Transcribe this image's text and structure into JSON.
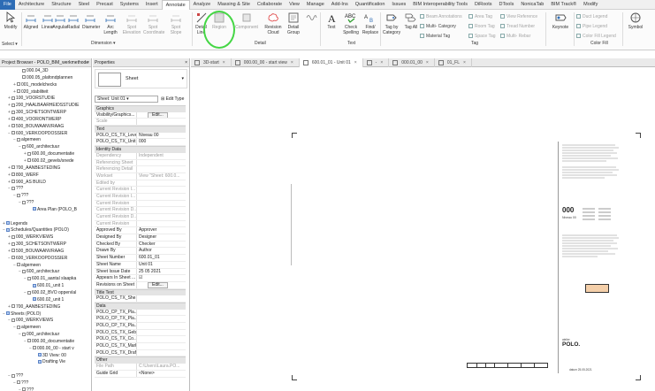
{
  "ribbon_tabs": [
    "File",
    "Architecture",
    "Structure",
    "Steel",
    "Precast",
    "Systems",
    "Insert",
    "Annotate",
    "Analyze",
    "Massing & Site",
    "Collaborate",
    "View",
    "Manage",
    "Add-Ins",
    "Quantification",
    "Issues",
    "BIM Interoperability Tools",
    "DiRoots",
    "DTools",
    "NonicaTab",
    "BIM Track®",
    "Modify"
  ],
  "active_tab": "Annotate",
  "ribbon": {
    "modify": "Modify",
    "select": "Select ▾",
    "dim_tools": [
      "Aligned",
      "Linear",
      "Angular",
      "Radial",
      "Diameter",
      "Arc Length",
      "Spot Elevation",
      "Spot Coordinate",
      "Spot Slope"
    ],
    "dimension_panel": "Dimension ▾",
    "detail_tools": [
      "Detail Line",
      "Region",
      "Component",
      "Revision Cloud",
      "Detail Group",
      "Insulation"
    ],
    "detail_panel": "Detail",
    "text_tools": [
      "Text",
      "Check Spelling",
      "Find/ Replace"
    ],
    "text_panel": "Text",
    "tag_tools": [
      "Tag by Category",
      "Tag All"
    ],
    "tag_small": [
      "Beam Annotations",
      "Multi- Category",
      "Material Tag",
      "Area Tag",
      "Room Tag",
      "Space Tag",
      "View Reference",
      "Tread Number",
      "Multi- Rebar"
    ],
    "tag_panel": "Tag",
    "keynote": "Keynote",
    "color_fill": [
      "Duct Legend",
      "Pipe Legend",
      "Color Fill Legend"
    ],
    "color_fill_panel": "Color Fill",
    "symbol": "Symbol"
  },
  "project_browser": {
    "title": "Project Browser - POLO_BIM_werkmethode",
    "rows": [
      {
        "indent": 3,
        "label": "000.04_3D",
        "toggle": ""
      },
      {
        "indent": 3,
        "label": "000.05_plafondplannen",
        "toggle": ""
      },
      {
        "indent": 2,
        "label": "001_modelchecks",
        "toggle": "+"
      },
      {
        "indent": 2,
        "label": "020_stabiliteit",
        "toggle": "+"
      },
      {
        "indent": 1,
        "label": "100_VOORSTUDIE",
        "toggle": "+"
      },
      {
        "indent": 1,
        "label": "200_HAALBAARHEIDSSTUDIE",
        "toggle": "+"
      },
      {
        "indent": 1,
        "label": "300_SCHETSONTWERP",
        "toggle": "+"
      },
      {
        "indent": 1,
        "label": "400_VOORONTWERP",
        "toggle": "+"
      },
      {
        "indent": 1,
        "label": "500_BOUWAANVRAAG",
        "toggle": "+"
      },
      {
        "indent": 1,
        "label": "600_VERKOOPDOSSIER",
        "toggle": "−"
      },
      {
        "indent": 2,
        "label": "algemeen",
        "toggle": "−"
      },
      {
        "indent": 3,
        "label": "600_architectuur",
        "toggle": "−"
      },
      {
        "indent": 4,
        "label": "600.00_documentatie",
        "toggle": "+"
      },
      {
        "indent": 4,
        "label": "600.02_gevels/snede",
        "toggle": "+"
      },
      {
        "indent": 1,
        "label": "700_AANBESTEDING",
        "toggle": "+"
      },
      {
        "indent": 1,
        "label": "800_WERF",
        "toggle": "+"
      },
      {
        "indent": 1,
        "label": "900_AS BUILD",
        "toggle": "+"
      },
      {
        "indent": 1,
        "label": "???",
        "toggle": "−"
      },
      {
        "indent": 2,
        "label": "???",
        "toggle": "−"
      },
      {
        "indent": 3,
        "label": "???",
        "toggle": "−"
      },
      {
        "indent": 5,
        "label": "Area Plan (POLO_B",
        "toggle": ""
      },
      {
        "indent": 0,
        "label": "",
        "toggle": ""
      },
      {
        "indent": 0,
        "label": "Legends",
        "toggle": "+"
      },
      {
        "indent": 0,
        "label": "Schedules/Quantities (POLO)",
        "toggle": "−"
      },
      {
        "indent": 1,
        "label": "000_WERKVIEWS",
        "toggle": "+"
      },
      {
        "indent": 1,
        "label": "300_SCHETSONTWERP",
        "toggle": "+"
      },
      {
        "indent": 1,
        "label": "500_BOUWAANVRAAG",
        "toggle": "+"
      },
      {
        "indent": 1,
        "label": "600_VERKOOPDOSSIER",
        "toggle": "−"
      },
      {
        "indent": 2,
        "label": "algemeen",
        "toggle": "−"
      },
      {
        "indent": 3,
        "label": "600_architectuur",
        "toggle": "−"
      },
      {
        "indent": 4,
        "label": "600.01_aantal slaapka",
        "toggle": "−"
      },
      {
        "indent": 5,
        "label": "600.01_unit 1",
        "toggle": ""
      },
      {
        "indent": 4,
        "label": "600.02_BVO oppervlal",
        "toggle": "−"
      },
      {
        "indent": 5,
        "label": "600.02_unit 1",
        "toggle": ""
      },
      {
        "indent": 1,
        "label": "700_AANBESTEDING",
        "toggle": "+"
      },
      {
        "indent": 0,
        "label": "Sheets (POLO)",
        "toggle": "−"
      },
      {
        "indent": 1,
        "label": "000_WERKVIEWS",
        "toggle": "−"
      },
      {
        "indent": 2,
        "label": "algemeen",
        "toggle": "−"
      },
      {
        "indent": 3,
        "label": "000_architectuur",
        "toggle": "−"
      },
      {
        "indent": 4,
        "label": "000.00_documentatie",
        "toggle": "−"
      },
      {
        "indent": 5,
        "label": "000.00_00 - start v",
        "toggle": "−"
      },
      {
        "indent": 6,
        "label": "3D View: 00",
        "toggle": ""
      },
      {
        "indent": 6,
        "label": "Drafting Vie",
        "toggle": ""
      },
      {
        "indent": 0,
        "label": "",
        "toggle": ""
      },
      {
        "indent": 1,
        "label": "???",
        "toggle": "−"
      },
      {
        "indent": 2,
        "label": "???",
        "toggle": "−"
      },
      {
        "indent": 3,
        "label": "???",
        "toggle": "−"
      }
    ]
  },
  "properties": {
    "title": "Properties",
    "type_name": "Sheet",
    "instance": "Sheet: Unit 01",
    "edit_type": "Edit Type",
    "edit_label": "Edit...",
    "rows": [
      {
        "kind": "group",
        "name": "Graphics"
      },
      {
        "kind": "row",
        "name": "Visibility/Graphics...",
        "value": "Edit...",
        "dim": false
      },
      {
        "kind": "row",
        "name": "Scale",
        "value": "",
        "dim": true
      },
      {
        "kind": "group",
        "name": "Text"
      },
      {
        "kind": "row",
        "name": "POLO_CS_TX_Level",
        "value": "Niveau 00",
        "dim": false
      },
      {
        "kind": "row",
        "name": "POLO_CS_TX_Unit...",
        "value": "000",
        "dim": false
      },
      {
        "kind": "group",
        "name": "Identity Data"
      },
      {
        "kind": "row",
        "name": "Dependency",
        "value": "Independent",
        "dim": true
      },
      {
        "kind": "row",
        "name": "Referencing Sheet",
        "value": "",
        "dim": true
      },
      {
        "kind": "row",
        "name": "Referencing Detail",
        "value": "",
        "dim": true
      },
      {
        "kind": "row",
        "name": "Workset",
        "value": "View \"Sheet: 600.0...",
        "dim": true
      },
      {
        "kind": "row",
        "name": "Edited by",
        "value": "",
        "dim": true
      },
      {
        "kind": "row",
        "name": "Current Revision I...",
        "value": "",
        "dim": true
      },
      {
        "kind": "row",
        "name": "Current Revision I...",
        "value": "",
        "dim": true
      },
      {
        "kind": "row",
        "name": "Current Revision",
        "value": "",
        "dim": true
      },
      {
        "kind": "row",
        "name": "Current Revision D...",
        "value": "",
        "dim": true
      },
      {
        "kind": "row",
        "name": "Current Revision D...",
        "value": "",
        "dim": true
      },
      {
        "kind": "row",
        "name": "Current Revision",
        "value": "",
        "dim": true
      },
      {
        "kind": "row",
        "name": "Approved By",
        "value": "Approver",
        "dim": false
      },
      {
        "kind": "row",
        "name": "Designed By",
        "value": "Designer",
        "dim": false
      },
      {
        "kind": "row",
        "name": "Checked By",
        "value": "Checker",
        "dim": false
      },
      {
        "kind": "row",
        "name": "Drawn By",
        "value": "Author",
        "dim": false
      },
      {
        "kind": "row",
        "name": "Sheet Number",
        "value": "600.01_01",
        "dim": false
      },
      {
        "kind": "row",
        "name": "Sheet Name",
        "value": "Unit 01",
        "dim": false
      },
      {
        "kind": "row",
        "name": "Sheet Issue Date",
        "value": "25 05 2021",
        "dim": false
      },
      {
        "kind": "row",
        "name": "Appears In Sheet ...",
        "value": "☑",
        "dim": false
      },
      {
        "kind": "row",
        "name": "Revisions on Sheet",
        "value": "Edit...",
        "dim": false
      },
      {
        "kind": "group",
        "name": "Title Text"
      },
      {
        "kind": "row",
        "name": "POLO_CS_TX_She...",
        "value": "",
        "dim": false
      },
      {
        "kind": "group",
        "name": "Data"
      },
      {
        "kind": "row",
        "name": "POLO_CP_TX_Pla...",
        "value": "",
        "dim": false
      },
      {
        "kind": "row",
        "name": "POLO_CP_TX_Pla...",
        "value": "",
        "dim": false
      },
      {
        "kind": "row",
        "name": "POLO_CP_TX_Pla...",
        "value": "",
        "dim": false
      },
      {
        "kind": "row",
        "name": "POLO_CS_TX_Geb...",
        "value": "",
        "dim": false
      },
      {
        "kind": "row",
        "name": "POLO_CS_TX_Co...",
        "value": "",
        "dim": false
      },
      {
        "kind": "row",
        "name": "POLO_CS_TX_Mark",
        "value": "",
        "dim": false
      },
      {
        "kind": "row",
        "name": "POLO_CS_TX_Draf...",
        "value": "",
        "dim": false
      },
      {
        "kind": "group",
        "name": "Other"
      },
      {
        "kind": "row",
        "name": "File Path",
        "value": "C:\\Users\\Laura.PO...",
        "dim": true
      },
      {
        "kind": "row",
        "name": "Guide Grid",
        "value": "<None>",
        "dim": false
      }
    ]
  },
  "view_tabs": [
    "3D-start",
    "000.00_00 - start view",
    "600.01_01 - Unit 01",
    "-",
    "000.01_00",
    "01_FL"
  ],
  "active_view_tab": 2,
  "sheet": {
    "unit_number": "000",
    "level": "Niveau 00",
    "logo_small": "atelier",
    "logo": "POLO.",
    "issue_date": "datum 25.05.2021"
  }
}
